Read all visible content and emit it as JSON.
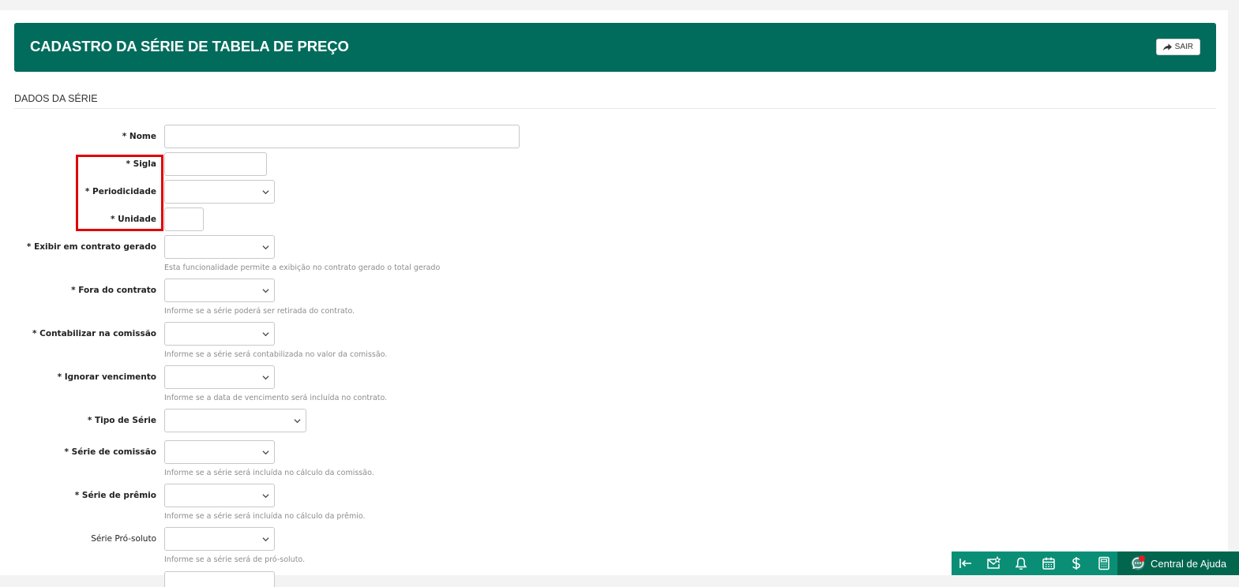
{
  "header": {
    "title": "CADASTRO DA SÉRIE DE TABELA DE PREÇO",
    "exit_label": "SAIR",
    "background_color": "#026c5c"
  },
  "section": {
    "title": "DADOS DA SÉRIE"
  },
  "form": {
    "fields": [
      {
        "label": "* Nome",
        "type": "text",
        "value": "",
        "help": ""
      },
      {
        "label": "* Sigla",
        "type": "text",
        "value": "",
        "help": ""
      },
      {
        "label": "* Periodicidade",
        "type": "select",
        "value": "",
        "help": ""
      },
      {
        "label": "* Unidade",
        "type": "text",
        "value": "",
        "help": ""
      },
      {
        "label": "* Exibir em contrato gerado",
        "type": "select",
        "value": "",
        "help": "Esta funcionalidade permite a exibição no contrato gerado o total gerado"
      },
      {
        "label": "* Fora do contrato",
        "type": "select",
        "value": "",
        "help": "Informe se a série poderá ser retirada do contrato."
      },
      {
        "label": "* Contabilizar na comissão",
        "type": "select",
        "value": "",
        "help": "Informe se a série será contabilizada no valor da comissão."
      },
      {
        "label": "* Ignorar vencimento",
        "type": "select",
        "value": "",
        "help": "Informe se a data de vencimento será incluída no contrato."
      },
      {
        "label": "* Tipo de Série",
        "type": "select",
        "value": "",
        "help": ""
      },
      {
        "label": "* Série de comissão",
        "type": "select",
        "value": "",
        "help": "Informe se a série será incluída no cálculo da comissão."
      },
      {
        "label": "* Série de prêmio",
        "type": "select",
        "value": "",
        "help": "Informe se a série será incluída no cálculo da prêmio."
      },
      {
        "label": "Série Pró-soluto",
        "type": "select",
        "value": "",
        "help": "Informe se a série será de pró-soluto."
      }
    ]
  },
  "highlight_color": "#e00000",
  "bottom_bar": {
    "icons": [
      "collapse-left-icon",
      "mail-star-icon",
      "bell-icon",
      "calendar-icon",
      "dollar-icon",
      "calculator-icon"
    ],
    "help_center_label": "Central de Ajuda",
    "background_color": "#0a8f76"
  }
}
